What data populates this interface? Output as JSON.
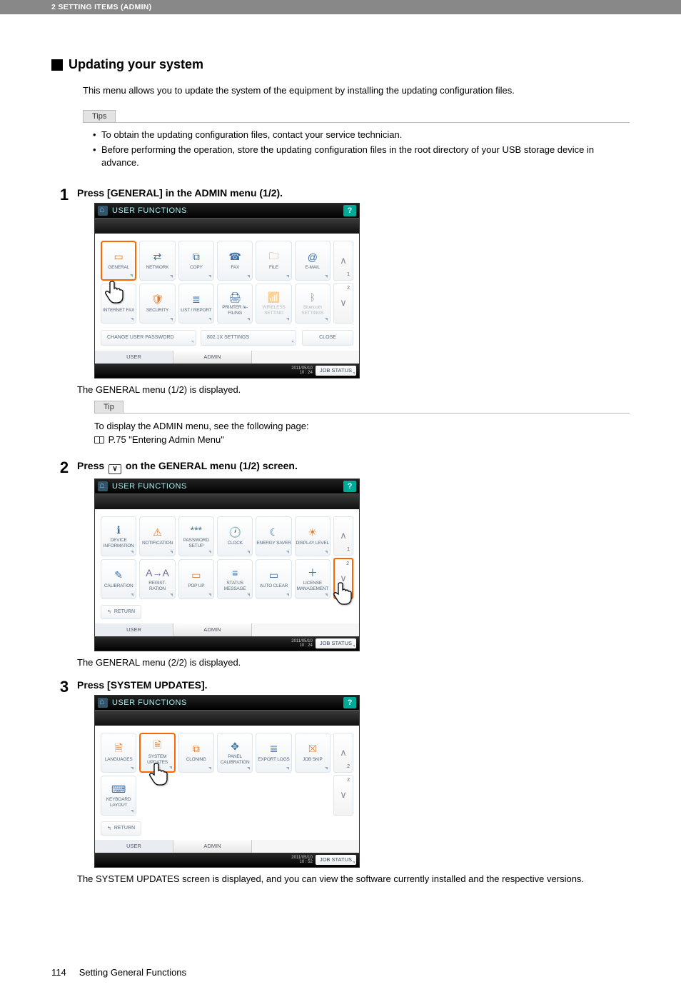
{
  "header": {
    "chapter": "2 SETTING ITEMS (ADMIN)"
  },
  "section": {
    "title": "Updating your system",
    "intro": "This menu allows you to update the system of the equipment by installing the updating configuration files."
  },
  "tipsBox": {
    "label": "Tips",
    "items": [
      "To obtain the updating configuration files, contact your service technician.",
      "Before performing the operation, store the updating configuration files in the root directory of your USB storage device in advance."
    ]
  },
  "steps": {
    "s1": {
      "num": "1",
      "title": "Press [GENERAL] in the ADMIN menu (1/2).",
      "caption": "The GENERAL menu (1/2) is displayed."
    },
    "s2": {
      "num": "2",
      "title_a": "Press ",
      "title_b": " on the GENERAL menu (1/2) screen.",
      "caption": "The GENERAL menu (2/2) is displayed."
    },
    "s3": {
      "num": "3",
      "title": "Press [SYSTEM UPDATES].",
      "caption": "The SYSTEM UPDATES screen is displayed, and you can view the software currently installed and the respective versions."
    }
  },
  "tipSingle": {
    "label": "Tip",
    "line1": "To display the ADMIN menu, see the following page:",
    "line2": "P.75 \"Entering Admin Menu\""
  },
  "ss_common": {
    "title": "USER FUNCTIONS",
    "help": "?",
    "tab_user": "USER",
    "tab_admin": "ADMIN",
    "jobstatus": "JOB STATUS",
    "close": "CLOSE",
    "return": "RETURN"
  },
  "ss1": {
    "btns": [
      "GENERAL",
      "NETWORK",
      "COPY",
      "FAX",
      "FILE",
      "E-MAIL",
      "INTERNET FAX",
      "SECURITY",
      "LIST / REPORT",
      "PRINTER /e-FILING",
      "WIRELESS SETTING",
      "Bluetooth SETTINGS"
    ],
    "bbtn1": "CHANGE USER PASSWORD",
    "bbtn2": "802.1X SETTINGS",
    "pager_top": "1",
    "pager_mid": "2",
    "datetime_a": "2011/05/10",
    "datetime_b": "10 : 24"
  },
  "ss2": {
    "btns": [
      "DEVICE INFORMATION",
      "NOTIFICATION",
      "PASSWORD SETUP",
      "CLOCK",
      "ENERGY SAVER",
      "DISPLAY LEVEL",
      "CALIBRATION",
      "REGIST- RATION",
      "POP UP",
      "STATUS MESSAGE",
      "AUTO CLEAR",
      "LICENSE MANAGEMENT"
    ],
    "pager_top": "1",
    "pager_mid": "2",
    "datetime_a": "2011/05/10",
    "datetime_b": "10 : 24"
  },
  "ss3": {
    "btns": [
      "LANGUAGES",
      "SYSTEM UPDATES",
      "CLONING",
      "PANEL CALIBRATION",
      "EXPORT LOGS",
      "JOB SKIP",
      "KEYBOARD LAYOUT"
    ],
    "pager_top": "2",
    "pager_mid": "2",
    "datetime_a": "2011/05/10",
    "datetime_b": "10 : 52"
  },
  "footer": {
    "page": "114",
    "title": "Setting General Functions"
  }
}
